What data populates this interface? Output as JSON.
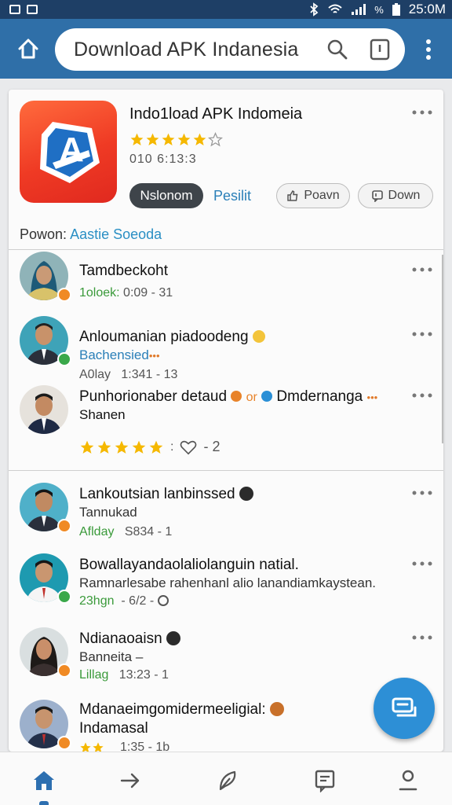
{
  "status_bar": {
    "time": "25:0M",
    "battery": "%"
  },
  "app_bar": {
    "search_text": "Download APK Indanesia"
  },
  "app": {
    "title": "Indo1load APK Indomeia",
    "icon_letter": "A",
    "rating_stars": 5.5,
    "meta": "010 6:13:3",
    "primary_button": "Nslonom",
    "link_label": "Pesilit",
    "power_button": "Poavn",
    "down_button": "Down",
    "owner_label": "Powon:",
    "owner_name": "Aastie Soeoda"
  },
  "reviews": [
    {
      "name": "Tamdbeckoht",
      "sub": "",
      "meta_label": "1oloek:",
      "meta_value": "0:09 - 31",
      "avatar": "woman-hijab",
      "badge": "orange"
    },
    {
      "name": "Anloumanian piadoodeng",
      "sub": "Bachensied",
      "meta_label": "A0lay",
      "meta_value": "1:341 - 13",
      "avatar": "man-1",
      "badge": "green"
    },
    {
      "name": "Punhorionaber detaud",
      "name_extra": "or",
      "name_extra2": "Dmdernanga",
      "sub": "Shanen",
      "meta_label": "",
      "meta_value": "- 2",
      "avatar": "man-2",
      "badge": "none",
      "stars": 5
    },
    {
      "name": "Lankoutsian lanbinssed",
      "sub": "Tannukad",
      "meta_label": "Aflday",
      "meta_value": "S834 - 1",
      "avatar": "man-3",
      "badge": "orange"
    },
    {
      "name": "Bowallayandaolaliolanguin natial.",
      "sub": "Ramnarlesabe rahenhanl alio lanandiamkaystean.",
      "meta_label": "23hgn",
      "meta_value": "- 6/2 -",
      "avatar": "boy",
      "badge": "green"
    },
    {
      "name": "Ndianaoaisn",
      "sub": "Banneita –",
      "meta_label": "Lillag",
      "meta_value": "13:23 - 1",
      "avatar": "woman",
      "badge": "orange"
    },
    {
      "name": "Mdanaeimgomidermeeligial:",
      "sub": "Indamasal",
      "meta_label": "",
      "meta_value": "1:35 - 1b",
      "avatar": "man-4",
      "badge": "orange"
    }
  ],
  "colors": {
    "status_bar": "#1e3f66",
    "app_bar": "#2f6fa8",
    "accent_blue": "#2a7fb8",
    "star": "#f5b800",
    "fab": "#2d8fd6"
  },
  "bottom_nav": [
    "home-icon",
    "arrow-right-icon",
    "feather-icon",
    "message-square-icon",
    "user-icon"
  ]
}
